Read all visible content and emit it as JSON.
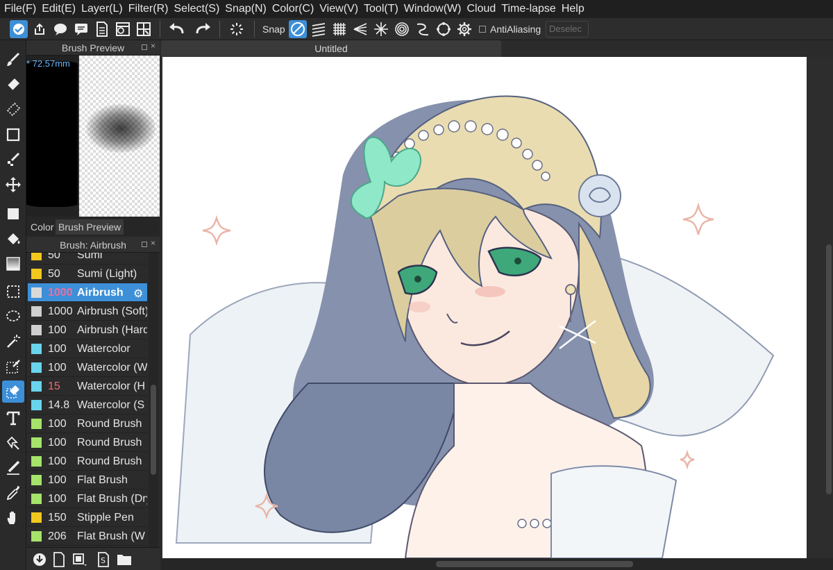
{
  "menu": [
    "File(F)",
    "Edit(E)",
    "Layer(L)",
    "Filter(R)",
    "Select(S)",
    "Snap(N)",
    "Color(C)",
    "View(V)",
    "Tool(T)",
    "Window(W)",
    "Cloud",
    "Time-lapse",
    "Help"
  ],
  "toolbar": {
    "snap_label": "Snap",
    "antialiasing_label": "AntiAliasing",
    "deselect_label": "Deselec"
  },
  "brush_preview": {
    "title": "Brush Preview",
    "size_readout": "* 72.57mm",
    "tabs": [
      "Color",
      "Brush Preview"
    ]
  },
  "brush_panel": {
    "title": "Brush: Airbrush",
    "items": [
      {
        "size": "50",
        "name": "Sumi",
        "color": "#f2c81e"
      },
      {
        "size": "50",
        "name": "Sumi (Light)",
        "color": "#f2c81e"
      },
      {
        "size": "1000",
        "name": "Airbrush",
        "color": "#d9d9d9"
      },
      {
        "size": "1000",
        "name": "Airbrush (Soft)",
        "color": "#cfcfcf"
      },
      {
        "size": "100",
        "name": "Airbrush (Hard)",
        "color": "#cfcfcf"
      },
      {
        "size": "100",
        "name": "Watercolor",
        "color": "#69d4ec"
      },
      {
        "size": "100",
        "name": "Watercolor (Wet)",
        "color": "#69d4ec"
      },
      {
        "size": "15",
        "name": "Watercolor (H",
        "color": "#69d4ec"
      },
      {
        "size": "14.8",
        "name": "Watercolor (S",
        "color": "#69d4ec"
      },
      {
        "size": "100",
        "name": "Round Brush",
        "color": "#a6e36a"
      },
      {
        "size": "100",
        "name": "Round Brush",
        "color": "#a6e36a"
      },
      {
        "size": "100",
        "name": "Round Brush",
        "color": "#a6e36a"
      },
      {
        "size": "100",
        "name": "Flat Brush",
        "color": "#a6e36a"
      },
      {
        "size": "100",
        "name": "Flat Brush (Dry)",
        "color": "#a6e36a"
      },
      {
        "size": "150",
        "name": "Stipple Pen",
        "color": "#f2c81e"
      },
      {
        "size": "206",
        "name": "Flat Brush (W",
        "color": "#a6e36a"
      }
    ]
  },
  "document": {
    "tab_title": "Untitled"
  },
  "colors": {
    "accent": "#3d8fd8",
    "hair": "#566180",
    "hair_light": "#e9dcb0",
    "skin": "#fbe9df",
    "eye": "#3fa87a",
    "butterfly": "#8fe8c8",
    "sparkle": "#e9b6a8"
  }
}
